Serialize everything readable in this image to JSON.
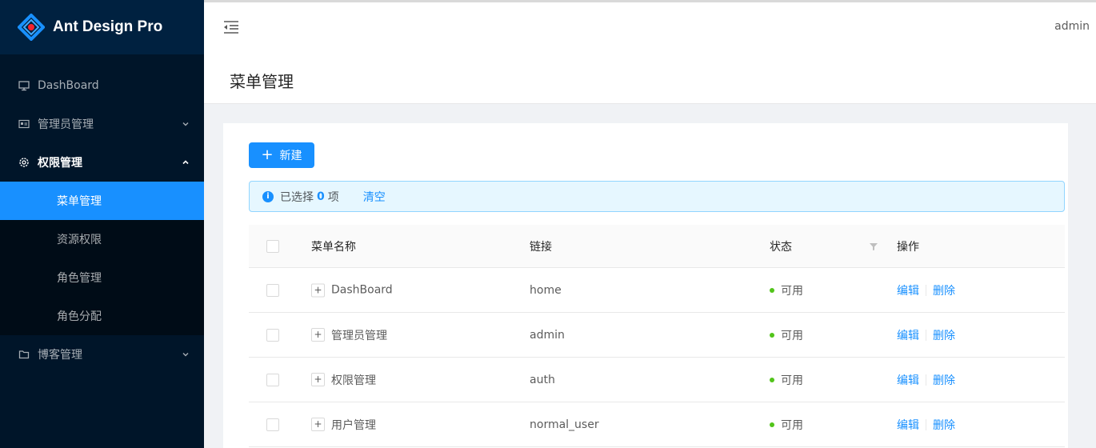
{
  "app": {
    "title": "Ant Design Pro",
    "user": "admin"
  },
  "sidebar": {
    "items": [
      {
        "label": "DashBoard",
        "icon": "desktop-icon"
      },
      {
        "label": "管理员管理",
        "icon": "idcard-icon"
      },
      {
        "label": "权限管理",
        "icon": "setting-icon",
        "open": true,
        "children": [
          {
            "label": "菜单管理",
            "selected": true
          },
          {
            "label": "资源权限"
          },
          {
            "label": "角色管理"
          },
          {
            "label": "角色分配"
          }
        ]
      },
      {
        "label": "博客管理",
        "icon": "folder-icon"
      }
    ]
  },
  "page": {
    "title": "菜单管理"
  },
  "toolbar": {
    "new_label": "新建"
  },
  "alert": {
    "prefix": "已选择",
    "count": "0",
    "suffix": "项",
    "clear_label": "清空"
  },
  "table": {
    "columns": [
      "菜单名称",
      "链接",
      "状态",
      "操作"
    ],
    "rows": [
      {
        "name": "DashBoard",
        "link": "home",
        "status": "可用",
        "edit": "编辑",
        "delete": "删除"
      },
      {
        "name": "管理员管理",
        "link": "admin",
        "status": "可用",
        "edit": "编辑",
        "delete": "删除"
      },
      {
        "name": "权限管理",
        "link": "auth",
        "status": "可用",
        "edit": "编辑",
        "delete": "删除"
      },
      {
        "name": "用户管理",
        "link": "normal_user",
        "status": "可用",
        "edit": "编辑",
        "delete": "删除"
      }
    ],
    "expand_symbol": "+"
  },
  "colors": {
    "primary": "#1890ff",
    "sider_bg": "#001529",
    "success": "#52c41a"
  }
}
